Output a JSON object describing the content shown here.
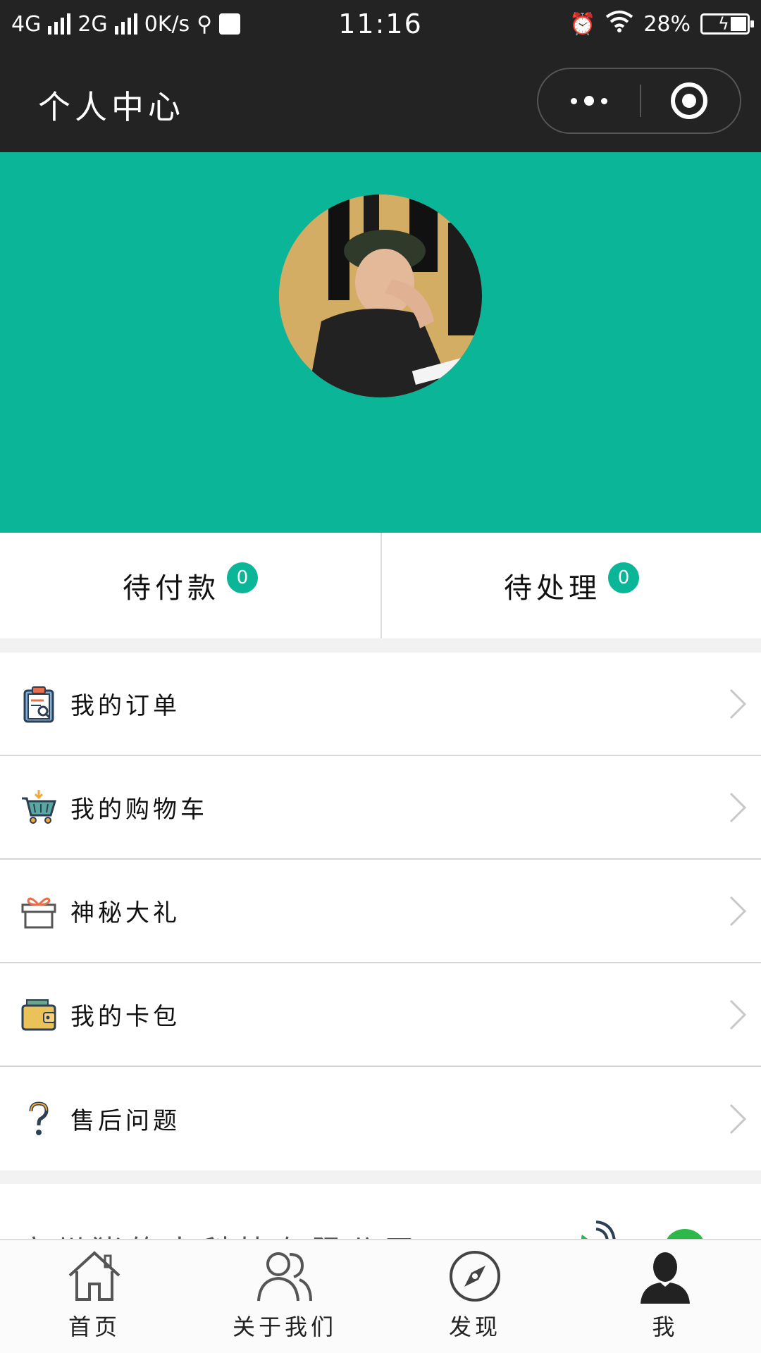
{
  "status_bar": {
    "network_1": "4G",
    "network_2": "2G",
    "speed": "0K/s",
    "time": "11:16",
    "battery": "28%"
  },
  "nav": {
    "title": "个人中心"
  },
  "profile": {
    "accent_color": "#0bb598"
  },
  "stats": [
    {
      "label": "待付款",
      "count": "0"
    },
    {
      "label": "待处理",
      "count": "0"
    }
  ],
  "menu": [
    {
      "label": "我的订单",
      "icon": "clipboard-icon"
    },
    {
      "label": "我的购物车",
      "icon": "shopping-cart-icon"
    },
    {
      "label": "神秘大礼",
      "icon": "gift-icon"
    },
    {
      "label": "我的卡包",
      "icon": "wallet-icon"
    },
    {
      "label": "售后问题",
      "icon": "question-icon"
    }
  ],
  "company": {
    "name": "广州猪的人科技有限公司"
  },
  "tabs": [
    {
      "label": "首页",
      "icon": "home-icon"
    },
    {
      "label": "关于我们",
      "icon": "users-icon"
    },
    {
      "label": "发现",
      "icon": "compass-icon"
    },
    {
      "label": "我",
      "icon": "person-icon"
    }
  ]
}
